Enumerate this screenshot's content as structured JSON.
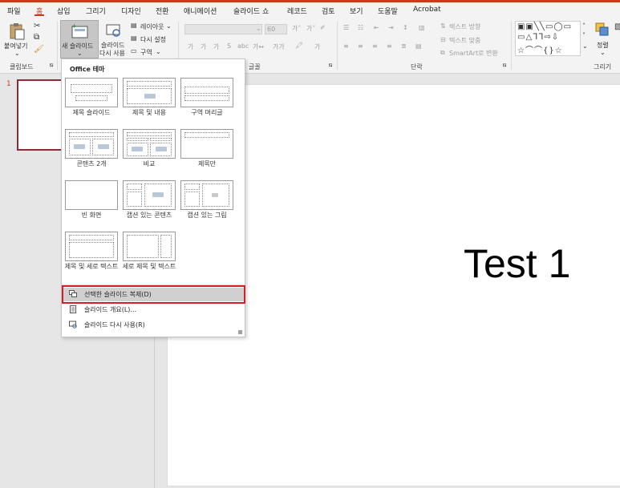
{
  "tabs": [
    {
      "label": "파일",
      "active": false
    },
    {
      "label": "홈",
      "active": true
    },
    {
      "label": "삽입",
      "active": false
    },
    {
      "label": "그리기",
      "active": false
    },
    {
      "label": "디자인",
      "active": false
    },
    {
      "label": "전환",
      "active": false
    },
    {
      "label": "애니메이션",
      "active": false
    },
    {
      "label": "슬라이드 쇼",
      "active": false
    },
    {
      "label": "레코드",
      "active": false
    },
    {
      "label": "검토",
      "active": false
    },
    {
      "label": "보기",
      "active": false
    },
    {
      "label": "도움말",
      "active": false
    },
    {
      "label": "Acrobat",
      "active": false
    }
  ],
  "ribbon": {
    "clipboard": {
      "paste": "붙여넣기",
      "group": "클립보드"
    },
    "slides": {
      "new_slide": "새 슬라이드",
      "reuse_line1": "슬라이드",
      "reuse_line2": "다시 사용",
      "layout": "레이아웃",
      "reset": "다시 설정",
      "section": "구역"
    },
    "font": {
      "size": "60",
      "group": "글꼴"
    },
    "paragraph": {
      "text_direction": "텍스트 방향",
      "align_text": "텍스트 맞춤",
      "smartart": "SmartArt로 변환",
      "group": "단락"
    },
    "drawing": {
      "arrange": "정렬",
      "group": "그리기"
    }
  },
  "thumbnail": {
    "number": "1"
  },
  "slide": {
    "text": "Test 1"
  },
  "dropdown": {
    "title": "Office 테마",
    "layouts": [
      {
        "caption": "제목 슬라이드"
      },
      {
        "caption": "제목 및 내용"
      },
      {
        "caption": "구역 머리글"
      },
      {
        "caption": "콘텐츠 2개"
      },
      {
        "caption": "비교"
      },
      {
        "caption": "제목만"
      },
      {
        "caption": "빈 화면"
      },
      {
        "caption": "캡션 있는 콘텐츠"
      },
      {
        "caption": "캡션 있는 그림"
      },
      {
        "caption": "제목 및 세로 텍스트"
      },
      {
        "caption": "세로 제목 및 텍스트"
      }
    ],
    "menu": [
      {
        "label": "선택한 슬라이드 복제(D)"
      },
      {
        "label": "슬라이드 개요(L)..."
      },
      {
        "label": "슬라이드 다시 사용(R)"
      }
    ]
  },
  "colors": {
    "accent": "#c43e1c",
    "highlight_box": "#d21f2a"
  }
}
